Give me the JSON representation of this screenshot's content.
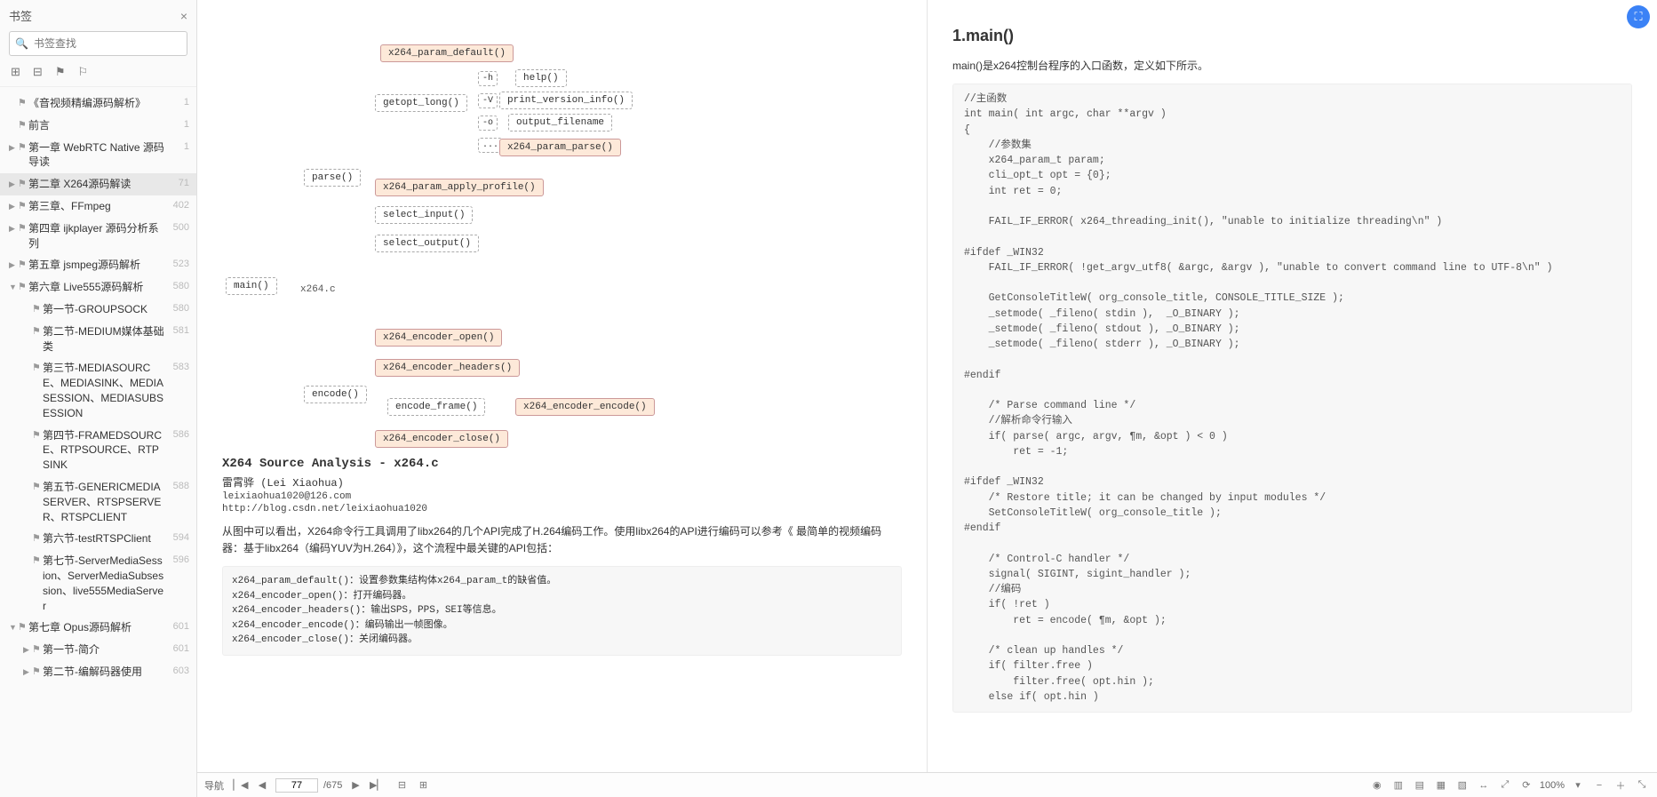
{
  "sidebar": {
    "title": "书签",
    "search_placeholder": "书签查找"
  },
  "toc": [
    {
      "lvl": 1,
      "caret": "",
      "label": "《音视频精编源码解析》",
      "page": "1",
      "sel": false
    },
    {
      "lvl": 1,
      "caret": "",
      "label": "前言",
      "page": "1",
      "sel": false
    },
    {
      "lvl": 1,
      "caret": "▶",
      "label": "第一章 WebRTC Native 源码导读",
      "page": "1",
      "sel": false
    },
    {
      "lvl": 1,
      "caret": "▶",
      "label": "第二章 X264源码解读",
      "page": "71",
      "sel": true
    },
    {
      "lvl": 1,
      "caret": "▶",
      "label": "第三章、FFmpeg",
      "page": "402",
      "sel": false
    },
    {
      "lvl": 1,
      "caret": "▶",
      "label": "第四章 ijkplayer 源码分析系列",
      "page": "500",
      "sel": false
    },
    {
      "lvl": 1,
      "caret": "▶",
      "label": "第五章 jsmpeg源码解析",
      "page": "523",
      "sel": false
    },
    {
      "lvl": 1,
      "caret": "▼",
      "label": "第六章 Live555源码解析",
      "page": "580",
      "sel": false
    },
    {
      "lvl": 2,
      "caret": "",
      "label": "第一节-GROUPSOCK",
      "page": "580",
      "sel": false
    },
    {
      "lvl": 2,
      "caret": "",
      "label": "第二节-MEDIUM媒体基础类",
      "page": "581",
      "sel": false
    },
    {
      "lvl": 2,
      "caret": "",
      "label": "第三节-MEDIASOURCE、MEDIASINK、MEDIASESSION、MEDIASUBSESSION",
      "page": "583",
      "sel": false
    },
    {
      "lvl": 2,
      "caret": "",
      "label": "第四节-FRAMEDSOURCE、RTPSOURCE、RTPSINK",
      "page": "586",
      "sel": false
    },
    {
      "lvl": 2,
      "caret": "",
      "label": "第五节-GENERICMEDIASERVER、RTSPSERVER、RTSPCLIENT",
      "page": "588",
      "sel": false
    },
    {
      "lvl": 2,
      "caret": "",
      "label": "第六节-testRTSPClient",
      "page": "594",
      "sel": false
    },
    {
      "lvl": 2,
      "caret": "",
      "label": "第七节-ServerMediaSession、ServerMediaSubsession、live555MediaServer",
      "page": "596",
      "sel": false
    },
    {
      "lvl": 1,
      "caret": "▼",
      "label": "第七章 Opus源码解析",
      "page": "601",
      "sel": false
    },
    {
      "lvl": 2,
      "caret": "▶",
      "label": "第一节-简介",
      "page": "601",
      "sel": false
    },
    {
      "lvl": 2,
      "caret": "▶",
      "label": "第二节-编解码器使用",
      "page": "603",
      "sel": false
    }
  ],
  "flow": {
    "main": "main()",
    "parse": "parse()",
    "encode": "encode()",
    "file": "x264.c",
    "getopt": "getopt_long()",
    "param_default": "x264_param_default()",
    "param_apply": "x264_param_apply_profile()",
    "select_input": "select_input()",
    "select_output": "select_output()",
    "enc_open": "x264_encoder_open()",
    "enc_headers": "x264_encoder_headers()",
    "enc_frame": "encode_frame()",
    "enc_close": "x264_encoder_close()",
    "help": "help()",
    "print_ver": "print_version_info()",
    "out_file": "output_filename",
    "param_parse": "x264_param_parse()",
    "enc_encode": "x264_encoder_encode()",
    "opt_h": "-h",
    "opt_v": "-V",
    "opt_o": "-o",
    "opt_dots": "..."
  },
  "source": {
    "title": "X264 Source Analysis - x264.c",
    "author": "雷霄骅 (Lei Xiaohua)",
    "email": "leixiaohua1020@126.com",
    "url": "http://blog.csdn.net/leixiaohua1020"
  },
  "body1": "从图中可以看出，X264命令行工具调用了libx264的几个API完成了H.264编码工作。使用libx264的API进行编码可以参考《 最简单的视频编码器：基于libx264（编码YUV为H.264）》，这个流程中最关键的API包括：",
  "api_list": "x264_param_default()：设置参数集结构体x264_param_t的缺省值。\nx264_encoder_open()：打开编码器。\nx264_encoder_headers()：输出SPS，PPS，SEI等信息。\nx264_encoder_encode()：编码输出一帧图像。\nx264_encoder_close()：关闭编码器。",
  "right": {
    "heading": "1.main()",
    "intro": "main()是x264控制台程序的入口函数，定义如下所示。",
    "code": "//主函数\nint main( int argc, char **argv )\n{\n    //参数集\n    x264_param_t param;\n    cli_opt_t opt = {0};\n    int ret = 0;\n\n    FAIL_IF_ERROR( x264_threading_init(), \"unable to initialize threading\\n\" )\n\n#ifdef _WIN32\n    FAIL_IF_ERROR( !get_argv_utf8( &argc, &argv ), \"unable to convert command line to UTF-8\\n\" )\n\n    GetConsoleTitleW( org_console_title, CONSOLE_TITLE_SIZE );\n    _setmode( _fileno( stdin ),  _O_BINARY );\n    _setmode( _fileno( stdout ), _O_BINARY );\n    _setmode( _fileno( stderr ), _O_BINARY );\n\n#endif\n\n    /* Parse command line */\n    //解析命令行输入\n    if( parse( argc, argv, ¶m, &opt ) < 0 )\n        ret = -1;\n\n#ifdef _WIN32\n    /* Restore title; it can be changed by input modules */\n    SetConsoleTitleW( org_console_title );\n#endif\n\n    /* Control-C handler */\n    signal( SIGINT, sigint_handler );\n    //编码\n    if( !ret )\n        ret = encode( ¶m, &opt );\n\n    /* clean up handles */\n    if( filter.free )\n        filter.free( opt.hin );\n    else if( opt.hin )"
  },
  "status": {
    "nav_label": "导航",
    "page_cur": "77",
    "page_total": "/675",
    "zoom": "100%"
  }
}
